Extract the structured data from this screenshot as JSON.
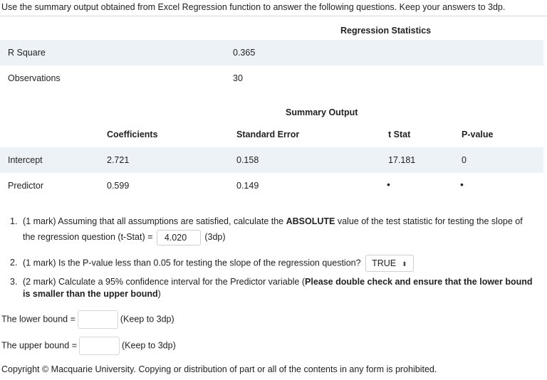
{
  "intro": "Use the summary output obtained from Excel Regression function to answer the following questions. Keep your answers to 3dp.",
  "regression_statistics": {
    "title": "Regression Statistics",
    "rows": [
      {
        "label": "R Square",
        "value": "0.365"
      },
      {
        "label": "Observations",
        "value": "30"
      }
    ]
  },
  "summary_output": {
    "title": "Summary Output",
    "headers": [
      "",
      "Coefficients",
      "Standard Error",
      "t Stat",
      "P-value"
    ],
    "rows": [
      {
        "label": "Intercept",
        "coef": "2.721",
        "se": "0.158",
        "tstat": "17.181",
        "pvalue": "0"
      },
      {
        "label": "Predictor",
        "coef": "0.599",
        "se": "0.149",
        "tstat": "•",
        "pvalue": "•"
      }
    ]
  },
  "questions": {
    "q1": {
      "number": "1.",
      "text_a": "(1 mark) Assuming that all assumptions are satisfied, calculate the ",
      "bold": "ABSOLUTE",
      "text_b": " value of the test statistic for testing the slope of",
      "text_c": "the regression question (t-Stat) = ",
      "answer": "4.020",
      "suffix": "(3dp)"
    },
    "q2": {
      "number": "2.",
      "text": "(1 mark) Is the P-value less than 0.05 for testing the slope of the regression question?",
      "selected": "TRUE",
      "arrow": "⬍"
    },
    "q3": {
      "number": "3.",
      "text_a": "(2 mark) Calculate a 95% confidence interval for the Predictor variable (",
      "bold": "Please double check and ensure that the lower bound is smaller than the upper bound",
      "text_b": ")"
    }
  },
  "bounds": {
    "lower_label": "The lower bound =",
    "lower_value": "",
    "lower_hint": "(Keep to 3dp)",
    "upper_label": "The upper bound =",
    "upper_value": "",
    "upper_hint": "(Keep to 3dp)"
  },
  "copyright": "Copyright © Macquarie University. Copying or distribution of part or all of the contents in any form is prohibited."
}
